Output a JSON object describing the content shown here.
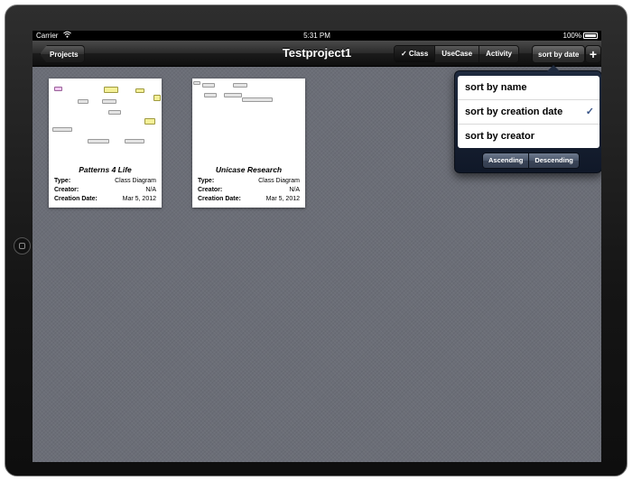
{
  "status_bar": {
    "carrier": "Carrier",
    "wifi_icon": "wifi-icon",
    "time": "5:31 PM",
    "battery": "100%"
  },
  "nav": {
    "back_label": "Projects",
    "title": "Testproject1",
    "filters": [
      "✓ Class",
      "UseCase",
      "Activity"
    ],
    "selected_filter": "✓ Class",
    "sort_label": "sort by date",
    "add_label": "+"
  },
  "projects": [
    {
      "name": "Patterns 4 Life",
      "type_label": "Type:",
      "type": "Class Diagram",
      "creator_label": "Creator:",
      "creator": "N/A",
      "date_label": "Creation Date:",
      "date": "Mar 5, 2012"
    },
    {
      "name": "Unicase Research",
      "type_label": "Type:",
      "type": "Class Diagram",
      "creator_label": "Creator:",
      "creator": "N/A",
      "date_label": "Creation Date:",
      "date": "Mar 5, 2012"
    }
  ],
  "sort_popover": {
    "options": [
      "sort by name",
      "sort by creation date",
      "sort by creator"
    ],
    "selected_option": "sort by creation date",
    "check": "✓",
    "order": [
      "Ascending",
      "Descending"
    ]
  },
  "colors": {
    "screen_bg": "#6b6e77",
    "popover_bg": "#1f2a3e",
    "check_color": "#385487"
  }
}
